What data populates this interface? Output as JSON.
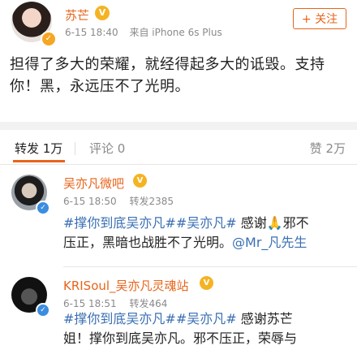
{
  "post": {
    "author": "苏芒",
    "vip_badge": "V",
    "time": "6-15 18:40",
    "source": "来自 iPhone 6s Plus",
    "follow_label": "+ 关注",
    "text_line1": "担得了多大的荣耀，就经得起多大的诋毁。支持",
    "text_line2": "你！黑，永远压不了光明。"
  },
  "tabs": {
    "repost": "转发 1万",
    "comment": "评论 0",
    "like": "赞 2万"
  },
  "reposts": [
    {
      "name": "吴亦凡微吧",
      "vip": "V",
      "time": "6-15 18:50",
      "count": "转发2385",
      "line1_hashtag1": "#撑你到底吴亦凡#",
      "line1_hashtag2": "#吴亦凡#",
      "line1_rest": "感谢🙏邪不",
      "line2": "压正，黑暗也战胜不了光明。",
      "mention": "@Mr_凡先生"
    },
    {
      "name": "KRISoul_吴亦凡灵魂站",
      "vip": "V",
      "time": "6-15 18:51",
      "count": "转发464",
      "line1_hashtag1": "#撑你到底吴亦凡#",
      "line1_hashtag2": "#吴亦凡#",
      "line1_rest": "感谢苏芒",
      "line2": "姐！撑你到底吴亦凡。邪不压正，荣辱与"
    }
  ],
  "colors": {
    "accent": "#e8641b",
    "link": "#3a6fb3",
    "vip": "#f5b323"
  }
}
